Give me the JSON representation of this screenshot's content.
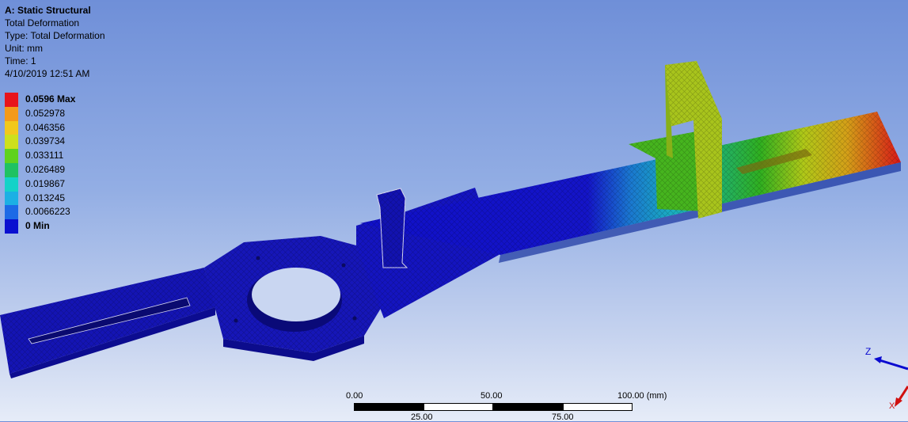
{
  "header": {
    "analysis": "A: Static Structural",
    "result": "Total Deformation",
    "type": "Type: Total Deformation",
    "unit": "Unit: mm",
    "time": "Time: 1",
    "date": "4/10/2019 12:51 AM"
  },
  "legend": {
    "entries": [
      {
        "label": "0.0596 Max",
        "color": "#e8141a",
        "bold": true
      },
      {
        "label": "0.052978",
        "color": "#f49a1a",
        "bold": false
      },
      {
        "label": "0.046356",
        "color": "#f2c81c",
        "bold": false
      },
      {
        "label": "0.039734",
        "color": "#cde01c",
        "bold": false
      },
      {
        "label": "0.033111",
        "color": "#5fd21e",
        "bold": false
      },
      {
        "label": "0.026489",
        "color": "#1fc262",
        "bold": false
      },
      {
        "label": "0.019867",
        "color": "#14d2c8",
        "bold": false
      },
      {
        "label": "0.013245",
        "color": "#1cb0e4",
        "bold": false
      },
      {
        "label": "0.0066223",
        "color": "#1c6ae6",
        "bold": false
      },
      {
        "label": "0 Min",
        "color": "#0a10d0",
        "bold": true
      }
    ]
  },
  "scale": {
    "top_labels": [
      "0.00",
      "50.00",
      "100.00 (mm)"
    ],
    "bottom_labels": [
      "25.00",
      "75.00"
    ]
  },
  "axes": {
    "z_label": "Z",
    "x_label": "X"
  }
}
